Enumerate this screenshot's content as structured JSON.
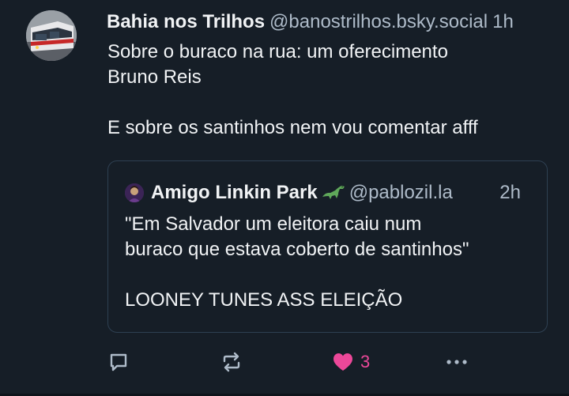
{
  "post": {
    "author": {
      "display_name": "Bahia nos Trilhos",
      "handle": "@banostrilhos.bsky.social",
      "time": "1h"
    },
    "text_lines": [
      "Sobre o buraco na rua: um oferecimento",
      "Bruno Reis",
      "E sobre os santinhos nem vou comentar afff"
    ],
    "quote": {
      "display_name": "Amigo Linkin Park",
      "emoji": "dinosaur-icon",
      "handle": "@pablozil.la",
      "time": "2h",
      "text_lines": [
        "\"Em Salvador um eleitora caiu num",
        "buraco que estava coberto de santinhos\"",
        "LOONEY TUNES ASS ELEIÇÃO"
      ]
    },
    "actions": {
      "reply_icon": "reply-icon",
      "repost_icon": "repost-icon",
      "like_icon": "heart-icon",
      "like_count": "3",
      "more_icon": "more-icon",
      "like_color": "#ec4899",
      "icon_color": "#aebbc9"
    }
  }
}
